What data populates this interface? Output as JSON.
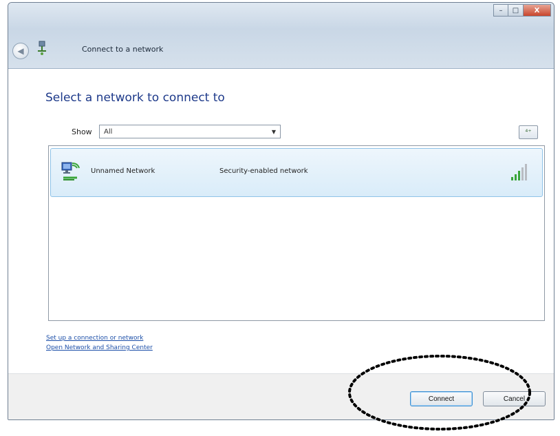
{
  "window": {
    "title": "Connect to a network",
    "controls": {
      "minimize": "–",
      "maximize": "□",
      "close": "X"
    }
  },
  "main": {
    "heading": "Select a network to connect to",
    "show_label": "Show",
    "show_value": "All",
    "refresh_icon": "refresh-icon"
  },
  "networks": [
    {
      "name": "Unnamed Network",
      "security": "Security-enabled network",
      "icon": "network-icon",
      "signal": "signal-strength-icon",
      "selected": true
    }
  ],
  "links": {
    "setup": "Set up a connection or network",
    "sharing": "Open Network and Sharing Center"
  },
  "buttons": {
    "connect": "Connect",
    "cancel": "Cancel"
  },
  "colors": {
    "heading": "#1e3a8a",
    "link": "#1b4ea8",
    "selection": "#d9ecf9",
    "signal": "#3aa63a"
  }
}
